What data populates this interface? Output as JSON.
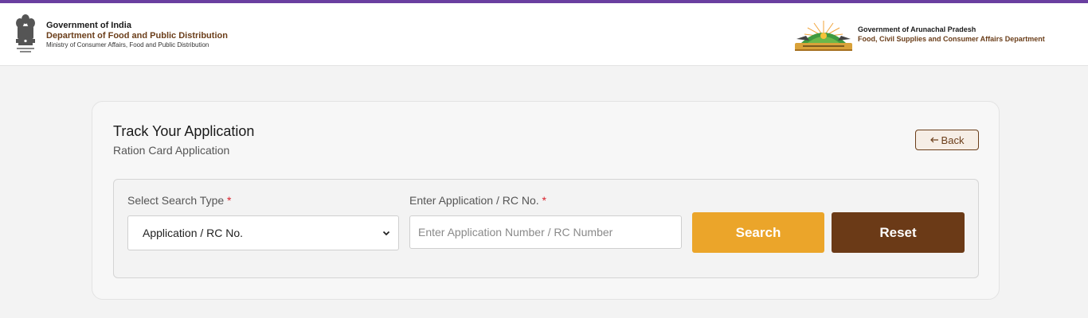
{
  "header": {
    "left": {
      "line1": "Government of India",
      "line2": "Department of Food and Public Distribution",
      "line3": "Ministry of Consumer Affairs, Food and Public Distribution"
    },
    "right": {
      "line1": "Government of Arunachal Pradesh",
      "line2": "Food, Civil Supplies and Consumer Affairs Department"
    }
  },
  "page": {
    "title": "Track Your Application",
    "subtitle": "Ration Card Application",
    "back_label": "Back"
  },
  "form": {
    "search_type_label": "Select Search Type",
    "search_type_value": "Application / RC No.",
    "number_label": "Enter Application / RC No.",
    "required_mark": "*",
    "number_placeholder": "Enter Application Number / RC Number",
    "number_value": ""
  },
  "buttons": {
    "search": "Search",
    "reset": "Reset"
  },
  "colors": {
    "top_accent": "#6a3fa0",
    "brand_brown": "#6b3a17",
    "search_orange": "#eba52a",
    "required_red": "#d9232e"
  },
  "icons": [
    "national-emblem-icon",
    "arunachal-emblem-icon",
    "arrow-left-icon",
    "chevron-down-icon"
  ]
}
